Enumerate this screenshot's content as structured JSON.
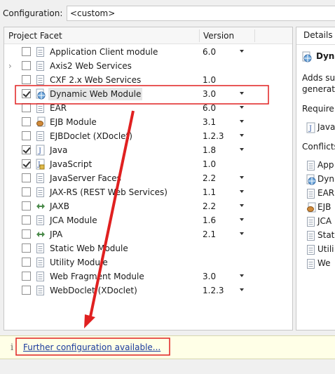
{
  "config": {
    "label": "Configuration:",
    "value": "<custom>"
  },
  "table": {
    "col_facet": "Project Facet",
    "col_version": "Version"
  },
  "facets": [
    {
      "name": "Application Client module",
      "version": "6.0",
      "checked": false,
      "icon": "page-icon",
      "dropdown": true,
      "expandable": false
    },
    {
      "name": "Axis2 Web Services",
      "version": "",
      "checked": false,
      "icon": "page-icon",
      "dropdown": false,
      "expandable": true
    },
    {
      "name": "CXF 2.x Web Services",
      "version": "1.0",
      "checked": false,
      "icon": "page-icon",
      "dropdown": false,
      "expandable": false
    },
    {
      "name": "Dynamic Web Module",
      "version": "3.0",
      "checked": true,
      "icon": "globe-icon",
      "dropdown": true,
      "expandable": false,
      "highlight": true
    },
    {
      "name": "EAR",
      "version": "6.0",
      "checked": false,
      "icon": "page-icon",
      "dropdown": true,
      "expandable": false
    },
    {
      "name": "EJB Module",
      "version": "3.1",
      "checked": false,
      "icon": "bean-icon",
      "dropdown": true,
      "expandable": false
    },
    {
      "name": "EJBDoclet (XDoclet)",
      "version": "1.2.3",
      "checked": false,
      "icon": "page-icon",
      "dropdown": true,
      "expandable": false
    },
    {
      "name": "Java",
      "version": "1.8",
      "checked": true,
      "icon": "java-icon",
      "dropdown": true,
      "expandable": false
    },
    {
      "name": "JavaScript",
      "version": "1.0",
      "checked": true,
      "icon": "javascript-icon",
      "dropdown": false,
      "expandable": false
    },
    {
      "name": "JavaServer Faces",
      "version": "2.2",
      "checked": false,
      "icon": "page-icon",
      "dropdown": true,
      "expandable": false
    },
    {
      "name": "JAX-RS (REST Web Services)",
      "version": "1.1",
      "checked": false,
      "icon": "page-icon",
      "dropdown": true,
      "expandable": false
    },
    {
      "name": "JAXB",
      "version": "2.2",
      "checked": false,
      "icon": "jaxb-icon",
      "dropdown": true,
      "expandable": false
    },
    {
      "name": "JCA Module",
      "version": "1.6",
      "checked": false,
      "icon": "page-icon",
      "dropdown": true,
      "expandable": false
    },
    {
      "name": "JPA",
      "version": "2.1",
      "checked": false,
      "icon": "jpa-icon",
      "dropdown": true,
      "expandable": false
    },
    {
      "name": "Static Web Module",
      "version": "",
      "checked": false,
      "icon": "page-icon",
      "dropdown": false,
      "expandable": false
    },
    {
      "name": "Utility Module",
      "version": "",
      "checked": false,
      "icon": "page-icon",
      "dropdown": false,
      "expandable": false
    },
    {
      "name": "Web Fragment Module",
      "version": "3.0",
      "checked": false,
      "icon": "page-icon",
      "dropdown": true,
      "expandable": false
    },
    {
      "name": "WebDoclet (XDoclet)",
      "version": "1.2.3",
      "checked": false,
      "icon": "page-icon",
      "dropdown": true,
      "expandable": false
    }
  ],
  "details": {
    "tab": "Details",
    "title": "Dyna",
    "desc_line1": "Adds su",
    "desc_line2": "generat",
    "requires_label": "Require",
    "requires": [
      {
        "text": "Java",
        "icon": "java-icon"
      }
    ],
    "conflicts_label": "Conflicts",
    "conflicts": [
      {
        "text": "App",
        "icon": "page-icon"
      },
      {
        "text": "Dyn",
        "icon": "globe-icon"
      },
      {
        "text": "EAR",
        "icon": "page-icon"
      },
      {
        "text": "EJB",
        "icon": "bean-icon"
      },
      {
        "text": "JCA",
        "icon": "page-icon"
      },
      {
        "text": "Stat",
        "icon": "page-icon"
      },
      {
        "text": "Utili",
        "icon": "page-icon"
      },
      {
        "text": "We",
        "icon": "page-icon"
      }
    ]
  },
  "footer": {
    "info_glyph": "i",
    "link": "Further configuration available..."
  },
  "colors": {
    "annotation_red": "#e02020",
    "link_blue": "#1a3a9c",
    "info_bar": "#ffffe7"
  }
}
